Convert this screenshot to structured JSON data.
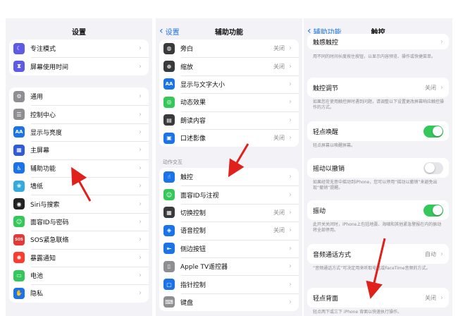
{
  "panel1": {
    "title": "设置",
    "top_items": [
      {
        "label": "专注模式",
        "icon": "moon-icon",
        "color": "#5e5ce6",
        "glyph": "☾"
      },
      {
        "label": "屏幕使用时间",
        "icon": "hourglass-icon",
        "color": "#5e5ce6",
        "glyph": "⧗"
      }
    ],
    "items": [
      {
        "label": "通用",
        "icon": "gear-icon",
        "color": "#8e8e93",
        "glyph": "⚙"
      },
      {
        "label": "控制中心",
        "icon": "switches-icon",
        "color": "#8e8e93",
        "glyph": "☰"
      },
      {
        "label": "显示与亮度",
        "icon": "brightness-icon",
        "color": "#1a73e8",
        "glyph": "AA"
      },
      {
        "label": "主屏幕",
        "icon": "home-grid-icon",
        "color": "#2f5bd8",
        "glyph": "▦"
      },
      {
        "label": "辅助功能",
        "icon": "accessibility-icon",
        "color": "#1a73e8",
        "glyph": "♿"
      },
      {
        "label": "墙纸",
        "icon": "wallpaper-icon",
        "color": "#35aadc",
        "glyph": "❀"
      },
      {
        "label": "Siri与搜索",
        "icon": "siri-icon",
        "color": "#222222",
        "glyph": "◉"
      },
      {
        "label": "面容ID与密码",
        "icon": "faceid-icon",
        "color": "#34c759",
        "glyph": "☺"
      },
      {
        "label": "SOS紧急联络",
        "icon": "sos-icon",
        "color": "#e53935",
        "glyph": "SOS"
      },
      {
        "label": "暴露通知",
        "icon": "exposure-icon",
        "color": "#ff3b30",
        "glyph": "✺"
      },
      {
        "label": "电池",
        "icon": "battery-icon",
        "color": "#34c759",
        "glyph": "▭"
      },
      {
        "label": "隐私",
        "icon": "hand-icon",
        "color": "#1a73e8",
        "glyph": "✋"
      }
    ]
  },
  "panel2": {
    "back_label": "设置",
    "title": "辅助功能",
    "top_items": [
      {
        "label": "旁白",
        "value": "关闭",
        "icon": "voiceover-icon",
        "color": "#3a3a3c",
        "glyph": "◍"
      },
      {
        "label": "缩放",
        "value": "关闭",
        "icon": "zoom-icon",
        "color": "#3a3a3c",
        "glyph": "⊕"
      },
      {
        "label": "显示与文字大小",
        "value": "",
        "icon": "text-size-icon",
        "color": "#1a73e8",
        "glyph": "AA"
      },
      {
        "label": "动态效果",
        "value": "",
        "icon": "motion-icon",
        "color": "#34c759",
        "glyph": "◎"
      },
      {
        "label": "朗读内容",
        "value": "",
        "icon": "speech-icon",
        "color": "#3a3a3c",
        "glyph": "▤"
      },
      {
        "label": "口述影像",
        "value": "关闭",
        "icon": "audio-description-icon",
        "color": "#1a73e8",
        "glyph": "▣"
      }
    ],
    "section_label": "动作交互",
    "items": [
      {
        "label": "触控",
        "value": "",
        "icon": "touch-icon",
        "color": "#1a73e8",
        "glyph": "☝"
      },
      {
        "label": "面容ID与注视",
        "value": "",
        "icon": "faceid-icon",
        "color": "#34c759",
        "glyph": "☺"
      },
      {
        "label": "切换控制",
        "value": "关闭",
        "icon": "switch-control-icon",
        "color": "#3a3a3c",
        "glyph": "▦"
      },
      {
        "label": "语音控制",
        "value": "关闭",
        "icon": "voice-control-icon",
        "color": "#1a73e8",
        "glyph": "◈"
      },
      {
        "label": "侧边按钮",
        "value": "",
        "icon": "side-button-icon",
        "color": "#1a73e8",
        "glyph": "⇤"
      },
      {
        "label": "Apple TV遥控器",
        "value": "",
        "icon": "remote-icon",
        "color": "#8e8e93",
        "glyph": "▯"
      },
      {
        "label": "指针控制",
        "value": "",
        "icon": "pointer-icon",
        "color": "#1a73e8",
        "glyph": "▢"
      },
      {
        "label": "键盘",
        "value": "",
        "icon": "keyboard-icon",
        "color": "#8e8e93",
        "glyph": "⌨"
      }
    ]
  },
  "panel3": {
    "back_label": "辅助功能",
    "title": "触控",
    "haptic": {
      "label": "触感触控",
      "desc": "用不同的时间长度按住按钮，以显示内容预览、操作或快捷菜单。"
    },
    "touch_accom": {
      "label": "触控调节",
      "value": "关闭",
      "desc": "如果您在使用触控屏时遇到问题，请调整以下设置更改屏幕响应触控操作的方式。"
    },
    "tap_wake": {
      "label": "轻点唤醒",
      "on": true,
      "desc": "轻点屏幕以唤醒屏幕。"
    },
    "shake_undo": {
      "label": "摇动以撤销",
      "on": false,
      "desc": "如果经常无意中摇动到iPhone，您可以停用“摇动以撤销”来避免出现“撤销”提醒。"
    },
    "vibration": {
      "label": "振动",
      "on": true,
      "desc": "此开关关闭时，iPhone上包括地震、海啸和其他紧急警报在内的振动将全部停用。"
    },
    "call_audio": {
      "label": "音频通话方式",
      "value": "自动",
      "desc": "“音频通话方式”可决定用来听取电话或FaceTime音频的方式。"
    },
    "back_tap": {
      "label": "轻点背面",
      "value": "关闭",
      "desc": "轻点两下或三下 iPhone 背面以快速执行操作。"
    }
  },
  "colors": {
    "accent": "#1a73e8",
    "toggle_on": "#34c759",
    "arrow": "#e0201b"
  }
}
